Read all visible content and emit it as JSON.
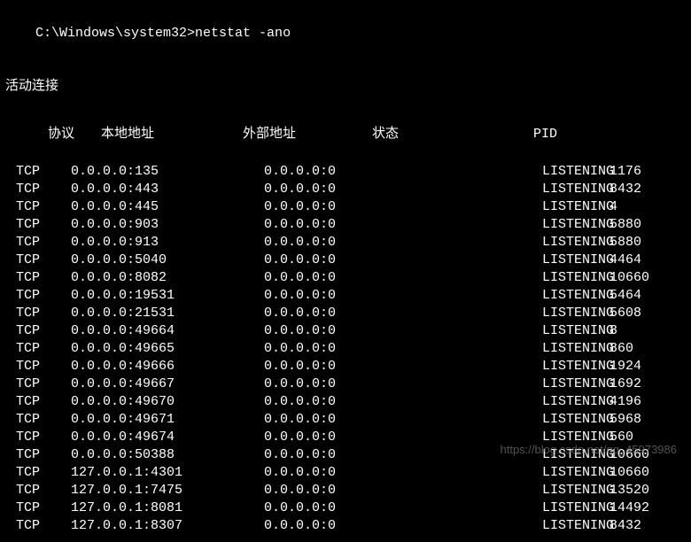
{
  "prompt": {
    "path": "C:\\Windows\\system32>",
    "command": "netstat -ano"
  },
  "heading": "活动连接",
  "headers": {
    "protocol": "协议",
    "local": "本地地址",
    "foreign": "外部地址",
    "state": "状态",
    "pid": "PID"
  },
  "rows": [
    {
      "proto": "TCP",
      "local": "0.0.0.0:135",
      "foreign": "0.0.0.0:0",
      "state": "LISTENING",
      "pid": "1176"
    },
    {
      "proto": "TCP",
      "local": "0.0.0.0:443",
      "foreign": "0.0.0.0:0",
      "state": "LISTENING",
      "pid": "8432"
    },
    {
      "proto": "TCP",
      "local": "0.0.0.0:445",
      "foreign": "0.0.0.0:0",
      "state": "LISTENING",
      "pid": "4"
    },
    {
      "proto": "TCP",
      "local": "0.0.0.0:903",
      "foreign": "0.0.0.0:0",
      "state": "LISTENING",
      "pid": "5880"
    },
    {
      "proto": "TCP",
      "local": "0.0.0.0:913",
      "foreign": "0.0.0.0:0",
      "state": "LISTENING",
      "pid": "5880"
    },
    {
      "proto": "TCP",
      "local": "0.0.0.0:5040",
      "foreign": "0.0.0.0:0",
      "state": "LISTENING",
      "pid": "4464"
    },
    {
      "proto": "TCP",
      "local": "0.0.0.0:8082",
      "foreign": "0.0.0.0:0",
      "state": "LISTENING",
      "pid": "10660"
    },
    {
      "proto": "TCP",
      "local": "0.0.0.0:19531",
      "foreign": "0.0.0.0:0",
      "state": "LISTENING",
      "pid": "5464"
    },
    {
      "proto": "TCP",
      "local": "0.0.0.0:21531",
      "foreign": "0.0.0.0:0",
      "state": "LISTENING",
      "pid": "5608"
    },
    {
      "proto": "TCP",
      "local": "0.0.0.0:49664",
      "foreign": "0.0.0.0:0",
      "state": "LISTENING",
      "pid": "8"
    },
    {
      "proto": "TCP",
      "local": "0.0.0.0:49665",
      "foreign": "0.0.0.0:0",
      "state": "LISTENING",
      "pid": "860"
    },
    {
      "proto": "TCP",
      "local": "0.0.0.0:49666",
      "foreign": "0.0.0.0:0",
      "state": "LISTENING",
      "pid": "1924"
    },
    {
      "proto": "TCP",
      "local": "0.0.0.0:49667",
      "foreign": "0.0.0.0:0",
      "state": "LISTENING",
      "pid": "1692"
    },
    {
      "proto": "TCP",
      "local": "0.0.0.0:49670",
      "foreign": "0.0.0.0:0",
      "state": "LISTENING",
      "pid": "4196"
    },
    {
      "proto": "TCP",
      "local": "0.0.0.0:49671",
      "foreign": "0.0.0.0:0",
      "state": "LISTENING",
      "pid": "5968"
    },
    {
      "proto": "TCP",
      "local": "0.0.0.0:49674",
      "foreign": "0.0.0.0:0",
      "state": "LISTENING",
      "pid": "560"
    },
    {
      "proto": "TCP",
      "local": "0.0.0.0:50388",
      "foreign": "0.0.0.0:0",
      "state": "LISTENING",
      "pid": "10660"
    },
    {
      "proto": "TCP",
      "local": "127.0.0.1:4301",
      "foreign": "0.0.0.0:0",
      "state": "LISTENING",
      "pid": "10660"
    },
    {
      "proto": "TCP",
      "local": "127.0.0.1:7475",
      "foreign": "0.0.0.0:0",
      "state": "LISTENING",
      "pid": "13520"
    },
    {
      "proto": "TCP",
      "local": "127.0.0.1:8081",
      "foreign": "0.0.0.0:0",
      "state": "LISTENING",
      "pid": "14492"
    },
    {
      "proto": "TCP",
      "local": "127.0.0.1:8307",
      "foreign": "0.0.0.0:0",
      "state": "LISTENING",
      "pid": "8432"
    }
  ],
  "watermark": "https://blog.csdn.net/qq_45973986"
}
